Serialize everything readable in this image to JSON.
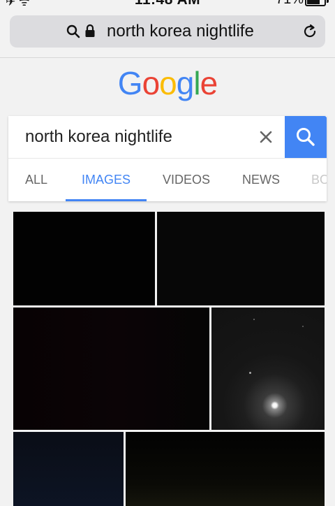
{
  "status_bar": {
    "time": "11:48 AM",
    "battery": "71%",
    "battery_level": 0.71
  },
  "url_bar": {
    "url": "north korea nightlife"
  },
  "logo": {
    "text": "Google",
    "letter_colors": [
      "#4285f4",
      "#ea4335",
      "#fbbc05",
      "#4285f4",
      "#34a853",
      "#ea4335"
    ]
  },
  "search": {
    "query": "north korea nightlife",
    "accent": "#4285f4"
  },
  "tabs": [
    {
      "label": "ALL",
      "active": false
    },
    {
      "label": "IMAGES",
      "active": true
    },
    {
      "label": "VIDEOS",
      "active": false
    },
    {
      "label": "NEWS",
      "active": false
    },
    {
      "label": "BO",
      "active": false
    }
  ],
  "icons": {
    "url_search": "search-icon",
    "url_lock": "lock-icon",
    "reload": "reload-icon",
    "clear": "close-icon",
    "search_button": "search-icon",
    "signal": "airplane-icon",
    "wifi": "wifi-icon",
    "battery": "battery-icon"
  }
}
